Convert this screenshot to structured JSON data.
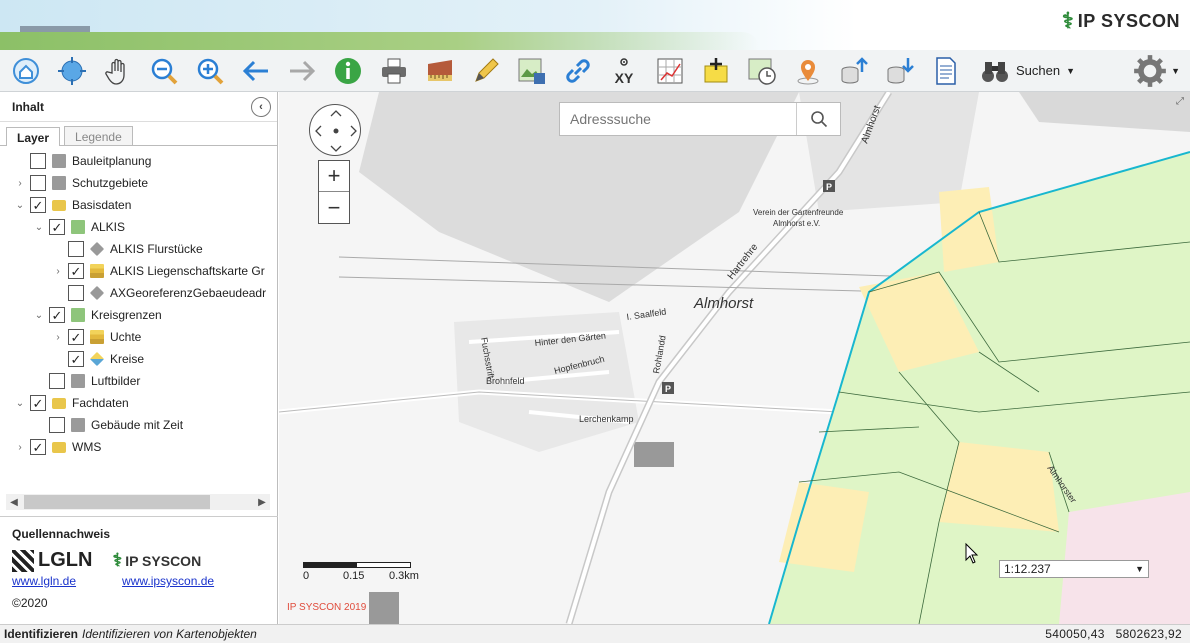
{
  "brand": {
    "name": "IP SYSCON"
  },
  "toolbar": {
    "tools": [
      {
        "name": "home-extent-tool"
      },
      {
        "name": "zoom-all-tool"
      },
      {
        "name": "pan-hand-tool"
      },
      {
        "name": "zoom-out-tool"
      },
      {
        "name": "zoom-in-tool"
      },
      {
        "name": "back-tool"
      },
      {
        "name": "forward-tool"
      },
      {
        "name": "info-tool"
      },
      {
        "name": "print-tool"
      },
      {
        "name": "measure-tool"
      },
      {
        "name": "draw-tool"
      },
      {
        "name": "save-map-tool"
      },
      {
        "name": "link-tool"
      },
      {
        "name": "xy-tool"
      },
      {
        "name": "grid-tool"
      },
      {
        "name": "add-object-tool"
      },
      {
        "name": "time-tool"
      },
      {
        "name": "location-tool"
      },
      {
        "name": "upload-tool"
      },
      {
        "name": "download-tool"
      },
      {
        "name": "document-tool"
      }
    ],
    "xy_label": "XY",
    "search_label": "Suchen"
  },
  "sidebar": {
    "title": "Inhalt",
    "tabs": [
      {
        "label": "Layer",
        "active": true
      },
      {
        "label": "Legende",
        "active": false
      }
    ],
    "tree": [
      {
        "label": "Bauleitplanung",
        "level": 0,
        "expander": "",
        "checked": false,
        "icon": "gray"
      },
      {
        "label": "Schutzgebiete",
        "level": 0,
        "expander": "›",
        "checked": false,
        "icon": "gray"
      },
      {
        "label": "Basisdaten",
        "level": 0,
        "expander": "⌄",
        "checked": true,
        "icon": "folder"
      },
      {
        "label": "ALKIS",
        "level": 1,
        "expander": "⌄",
        "checked": true,
        "icon": "green"
      },
      {
        "label": "ALKIS Flurstücke",
        "level": 2,
        "expander": "",
        "checked": false,
        "icon": "diamond"
      },
      {
        "label": "ALKIS Liegenschaftskarte Gr",
        "level": 2,
        "expander": "›",
        "checked": true,
        "icon": "layers"
      },
      {
        "label": "AXGeoreferenzGebaeudeadr",
        "level": 2,
        "expander": "",
        "checked": false,
        "icon": "diamond"
      },
      {
        "label": "Kreisgrenzen",
        "level": 1,
        "expander": "⌄",
        "checked": true,
        "icon": "green"
      },
      {
        "label": "Uchte",
        "level": 2,
        "expander": "›",
        "checked": true,
        "icon": "layers"
      },
      {
        "label": "Kreise",
        "level": 2,
        "expander": "",
        "checked": true,
        "icon": "kreis"
      },
      {
        "label": "Luftbilder",
        "level": 1,
        "expander": "",
        "checked": false,
        "icon": "gray"
      },
      {
        "label": "Fachdaten",
        "level": 0,
        "expander": "⌄",
        "checked": true,
        "icon": "folder"
      },
      {
        "label": "Gebäude mit Zeit",
        "level": 1,
        "expander": "",
        "checked": false,
        "icon": "gray"
      },
      {
        "label": "WMS",
        "level": 0,
        "expander": "›",
        "checked": true,
        "icon": "folder"
      }
    ],
    "sources": {
      "title": "Quellennachweis",
      "lgln": "LGLN",
      "ipsyscon": "IP SYSCON",
      "lgln_link": "www.lgln.de",
      "ipsyscon_link": "www.ipsyscon.de",
      "copyright": "©2020"
    }
  },
  "map": {
    "search_placeholder": "Adresssuche",
    "scale_value": "1:12.237",
    "scalebar": {
      "t0": "0",
      "t1": "0.15",
      "t2": "0.3km"
    },
    "copyright": "IP SYSCON 2019",
    "labels": {
      "town": "Almhorst",
      "road1": "Hartrehre",
      "road2": "Almhorst",
      "verein1": "Verein der Gartenfreunde",
      "verein2": "Almhorst e.V.",
      "s1": "I. Saalfeld",
      "s2": "Hinter den Gärten",
      "s3": "Hopfenbruch",
      "s4": "Fuchsstrift",
      "s5": "Brohnfeld",
      "s6": "Rohlandd",
      "s7": "Lerchenkamp",
      "s8": "Almhorster",
      "p": "P"
    }
  },
  "status": {
    "mode": "Identifizieren",
    "description": "Identifizieren von Kartenobjekten",
    "x": "540050,43",
    "y": "5802623,92"
  },
  "colors": {
    "field_green": "#dff5c6",
    "field_yellow": "#fdeeb5",
    "boundary_cyan": "#18b7cf",
    "parcel_line": "#3d6a3d"
  }
}
